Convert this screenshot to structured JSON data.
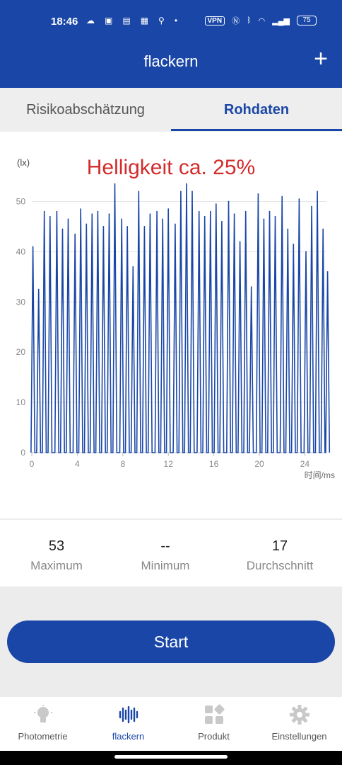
{
  "status_bar": {
    "time": "18:46",
    "vpn": "VPN",
    "battery": "75"
  },
  "app": {
    "title": "flackern",
    "add_icon": "plus-icon"
  },
  "tabs": [
    {
      "label": "Risikoabschätzung",
      "active": false
    },
    {
      "label": "Rohdaten",
      "active": true
    }
  ],
  "chart_data": {
    "type": "line",
    "title": "Helligkeit ca. 25%",
    "ylabel": "(lx)",
    "xlabel": "时间/ms",
    "xlim": [
      0,
      25.9
    ],
    "ylim": [
      0,
      55
    ],
    "xticks": [
      0,
      4,
      8,
      12,
      16,
      20,
      24
    ],
    "yticks": [
      0,
      10,
      20,
      30,
      40,
      50
    ],
    "grid": true,
    "color": "#1a47a7",
    "peaks": [
      [
        0.1,
        41
      ],
      [
        0.6,
        32.5
      ],
      [
        1.1,
        48
      ],
      [
        1.6,
        47
      ],
      [
        2.2,
        48
      ],
      [
        2.7,
        44.5
      ],
      [
        3.2,
        46.5
      ],
      [
        3.8,
        43.5
      ],
      [
        4.3,
        48.5
      ],
      [
        4.8,
        45.5
      ],
      [
        5.3,
        47.5
      ],
      [
        5.8,
        48
      ],
      [
        6.3,
        45
      ],
      [
        6.8,
        47.5
      ],
      [
        7.3,
        53.5
      ],
      [
        7.9,
        46.5
      ],
      [
        8.4,
        45
      ],
      [
        8.9,
        37
      ],
      [
        9.4,
        52
      ],
      [
        9.9,
        45
      ],
      [
        10.4,
        47.5
      ],
      [
        11.0,
        48
      ],
      [
        11.5,
        46.5
      ],
      [
        12.0,
        48.5
      ],
      [
        12.6,
        45.5
      ],
      [
        13.1,
        52
      ],
      [
        13.6,
        53.5
      ],
      [
        14.1,
        52
      ],
      [
        14.7,
        48
      ],
      [
        15.2,
        47
      ],
      [
        15.7,
        48
      ],
      [
        16.2,
        49.5
      ],
      [
        16.7,
        46
      ],
      [
        17.3,
        50
      ],
      [
        17.8,
        47.5
      ],
      [
        18.3,
        42
      ],
      [
        18.8,
        48
      ],
      [
        19.3,
        33
      ],
      [
        19.9,
        51.5
      ],
      [
        20.4,
        46.5
      ],
      [
        20.9,
        48
      ],
      [
        21.4,
        47
      ],
      [
        22.0,
        51
      ],
      [
        22.5,
        44.5
      ],
      [
        23.0,
        41.5
      ],
      [
        23.5,
        50.5
      ],
      [
        24.1,
        40
      ],
      [
        24.6,
        49
      ],
      [
        25.1,
        52
      ],
      [
        25.6,
        44.5
      ],
      [
        26.0,
        36
      ]
    ]
  },
  "stats": [
    {
      "value": "53",
      "label": "Maximum"
    },
    {
      "value": "--",
      "label": "Minimum"
    },
    {
      "value": "17",
      "label": "Durchschnitt"
    }
  ],
  "start_button": {
    "label": "Start"
  },
  "nav": [
    {
      "label": "Photometrie",
      "icon": "bulb-icon",
      "active": false
    },
    {
      "label": "flackern",
      "icon": "waveform-icon",
      "active": true
    },
    {
      "label": "Produkt",
      "icon": "grid-icon",
      "active": false
    },
    {
      "label": "Einstellungen",
      "icon": "gear-icon",
      "active": false
    }
  ]
}
